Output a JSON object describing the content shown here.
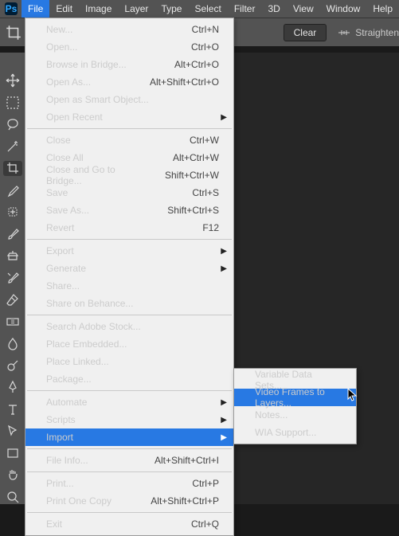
{
  "menubar": {
    "items": [
      "File",
      "Edit",
      "Image",
      "Layer",
      "Type",
      "Select",
      "Filter",
      "3D",
      "View",
      "Window",
      "Help"
    ],
    "open_index": 0
  },
  "optionsbar": {
    "clear_label": "Clear",
    "straighten_label": "Straighten"
  },
  "file_menu": {
    "groups": [
      [
        {
          "label": "New...",
          "shortcut": "Ctrl+N"
        },
        {
          "label": "Open...",
          "shortcut": "Ctrl+O"
        },
        {
          "label": "Browse in Bridge...",
          "shortcut": "Alt+Ctrl+O"
        },
        {
          "label": "Open As...",
          "shortcut": "Alt+Shift+Ctrl+O"
        },
        {
          "label": "Open as Smart Object..."
        },
        {
          "label": "Open Recent",
          "submenu": true
        }
      ],
      [
        {
          "label": "Close",
          "shortcut": "Ctrl+W"
        },
        {
          "label": "Close All",
          "shortcut": "Alt+Ctrl+W"
        },
        {
          "label": "Close and Go to Bridge...",
          "shortcut": "Shift+Ctrl+W"
        },
        {
          "label": "Save",
          "shortcut": "Ctrl+S"
        },
        {
          "label": "Save As...",
          "shortcut": "Shift+Ctrl+S"
        },
        {
          "label": "Revert",
          "shortcut": "F12"
        }
      ],
      [
        {
          "label": "Export",
          "submenu": true
        },
        {
          "label": "Generate",
          "submenu": true
        },
        {
          "label": "Share..."
        },
        {
          "label": "Share on Behance..."
        }
      ],
      [
        {
          "label": "Search Adobe Stock..."
        },
        {
          "label": "Place Embedded..."
        },
        {
          "label": "Place Linked..."
        },
        {
          "label": "Package..."
        }
      ],
      [
        {
          "label": "Automate",
          "submenu": true
        },
        {
          "label": "Scripts",
          "submenu": true
        },
        {
          "label": "Import",
          "submenu": true,
          "highlight": true
        }
      ],
      [
        {
          "label": "File Info...",
          "shortcut": "Alt+Shift+Ctrl+I"
        }
      ],
      [
        {
          "label": "Print...",
          "shortcut": "Ctrl+P"
        },
        {
          "label": "Print One Copy",
          "shortcut": "Alt+Shift+Ctrl+P"
        }
      ],
      [
        {
          "label": "Exit",
          "shortcut": "Ctrl+Q"
        }
      ]
    ]
  },
  "import_submenu": {
    "items": [
      {
        "label": "Variable Data Sets..."
      },
      {
        "label": "Video Frames to Layers...",
        "highlight": true
      },
      {
        "label": "Notes..."
      },
      {
        "label": "WIA Support..."
      }
    ]
  }
}
